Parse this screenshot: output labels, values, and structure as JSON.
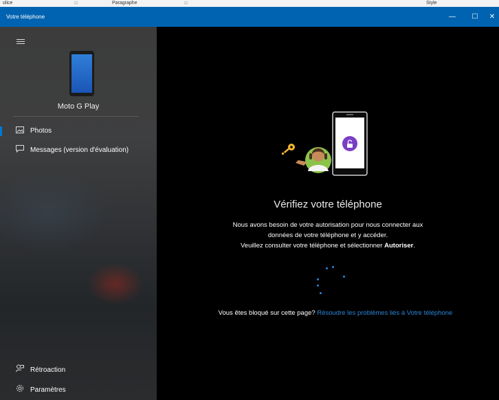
{
  "ribbon": {
    "left": "olice",
    "mid": "Paragraphe",
    "right": "Style",
    "launcher": "⊡"
  },
  "app": {
    "title": "Votre téléphone"
  },
  "window": {
    "min": "—",
    "max": "☐",
    "close": "✕"
  },
  "sidebar": {
    "device_name": "Moto G Play",
    "items": [
      {
        "label": "Photos",
        "icon": "photo-icon"
      },
      {
        "label": "Messages (version d'évaluation)",
        "icon": "message-icon"
      }
    ],
    "bottom": [
      {
        "label": "Rétroaction",
        "icon": "feedback-icon"
      },
      {
        "label": "Paramètres",
        "icon": "gear-icon"
      }
    ]
  },
  "main": {
    "heading": "Vérifiez votre téléphone",
    "body_line1": "Nous avons besoin de votre autorisation pour nous connecter aux",
    "body_line2": "données de votre téléphone et y accéder.",
    "body_line3": "Veuillez consulter votre téléphone et sélectionner",
    "body_bold": "Autoriser",
    "body_end": ".",
    "help_prefix": "Vous êtes bloqué sur cette page?",
    "help_link": "Résoudre les problèmes liés à Votre téléphone"
  },
  "colors": {
    "accent": "#0078d7",
    "titlebar": "#0063b1",
    "link": "#2b86d8"
  }
}
